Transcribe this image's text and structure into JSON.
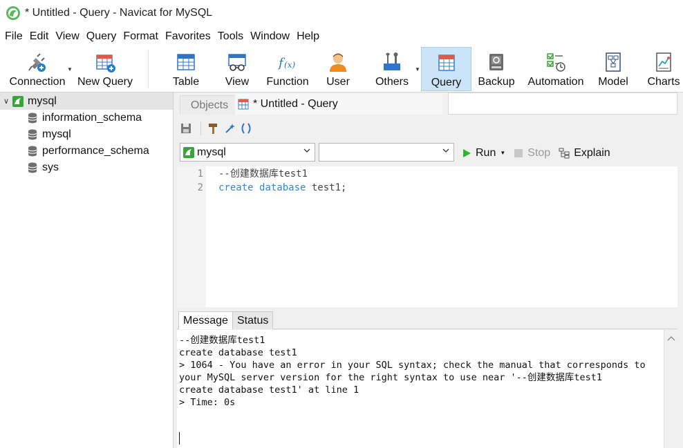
{
  "window": {
    "title": "* Untitled - Query - Navicat for MySQL"
  },
  "menu": [
    "File",
    "Edit",
    "View",
    "Query",
    "Format",
    "Favorites",
    "Tools",
    "Window",
    "Help"
  ],
  "toolbar": {
    "connection": "Connection",
    "new_query": "New Query",
    "table": "Table",
    "view": "View",
    "function": "Function",
    "user": "User",
    "others": "Others",
    "query": "Query",
    "backup": "Backup",
    "automation": "Automation",
    "model": "Model",
    "charts": "Charts"
  },
  "sidebar": {
    "connection": "mysql",
    "databases": [
      "information_schema",
      "mysql",
      "performance_schema",
      "sys"
    ]
  },
  "tabs": {
    "objects": "Objects",
    "query": "* Untitled - Query"
  },
  "selectors": {
    "connection_value": "mysql",
    "database_value": ""
  },
  "run_bar": {
    "run": "Run",
    "stop": "Stop",
    "explain": "Explain"
  },
  "editor": {
    "line_numbers": [
      "1",
      "2"
    ],
    "line1": "--创建数据库test1",
    "line2_kw1": "create",
    "line2_kw2": "database",
    "line2_rest": " test1;"
  },
  "message_tabs": {
    "message": "Message",
    "status": "Status"
  },
  "message_lines": [
    "--创建数据库test1",
    "create database test1",
    "> 1064 - You have an error in your SQL syntax; check the manual that corresponds to",
    "your MySQL server version for the right syntax to use near '--创建数据库test1",
    "create database test1' at line 1",
    "> Time: 0s"
  ],
  "colors": {
    "accent": "#cce4f7",
    "keyword": "#2a8ad6",
    "run_green": "#2db52d"
  }
}
